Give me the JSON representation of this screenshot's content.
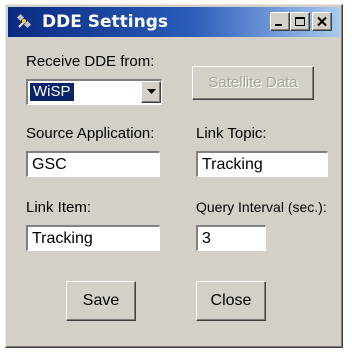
{
  "window": {
    "title": "DDE Settings",
    "icons": {
      "app": "satellite-icon",
      "minimize": "minimize-icon",
      "maximize": "maximize-icon",
      "close": "close-icon"
    }
  },
  "receive": {
    "label": "Receive DDE from:",
    "selected": "WiSP",
    "dropdown_icon": "chevron-down-icon"
  },
  "satellite_button": {
    "label": "Satellite Data",
    "enabled": false
  },
  "source_application": {
    "label": "Source Application:",
    "value": "GSC"
  },
  "link_topic": {
    "label": "Link Topic:",
    "value": "Tracking"
  },
  "link_item": {
    "label": "Link Item:",
    "value": "Tracking"
  },
  "query_interval": {
    "label": "Query Interval (sec.):",
    "value": "3"
  },
  "actions": {
    "save_label": "Save",
    "close_label": "Close"
  },
  "colors": {
    "face": "#d4d0c8",
    "title_start": "#0a2a82",
    "title_end": "#a6caf0",
    "selection": "#0a246a",
    "disabled_text": "#a8a59c"
  }
}
